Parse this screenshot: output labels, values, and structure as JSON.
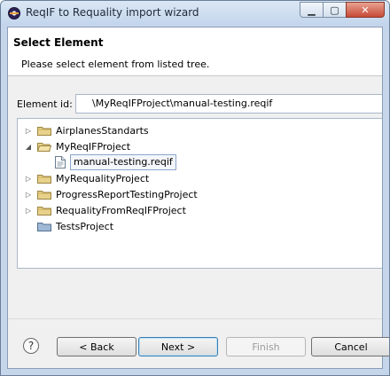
{
  "window": {
    "title": "ReqIF to Requality import wizard",
    "controls": {
      "minimize": "▁",
      "maximize": "▢",
      "close": "✕"
    }
  },
  "header": {
    "title": "Select Element",
    "message": "Please select element from listed tree."
  },
  "element_id": {
    "label": "Element id:",
    "value": "\\MyReqIFProject\\manual-testing.reqif"
  },
  "tree": {
    "items": [
      {
        "label": "AirplanesStandarts",
        "expander": "▷",
        "icon": "folder-icon"
      },
      {
        "label": "MyReqIFProject",
        "expander": "◢",
        "icon": "folder-open-icon"
      },
      {
        "label": "manual-testing.reqif",
        "expander": "",
        "icon": "file-icon",
        "selected": true
      },
      {
        "label": "MyRequalityProject",
        "expander": "▷",
        "icon": "folder-icon"
      },
      {
        "label": "ProgressReportTestingProject",
        "expander": "▷",
        "icon": "folder-icon"
      },
      {
        "label": "RequalityFromReqIFProject",
        "expander": "▷",
        "icon": "folder-icon"
      },
      {
        "label": "TestsProject",
        "expander": "",
        "icon": "folder-closed-icon"
      }
    ]
  },
  "footer": {
    "help": "?",
    "back": "< Back",
    "next": "Next >",
    "finish": "Finish",
    "cancel": "Cancel"
  }
}
